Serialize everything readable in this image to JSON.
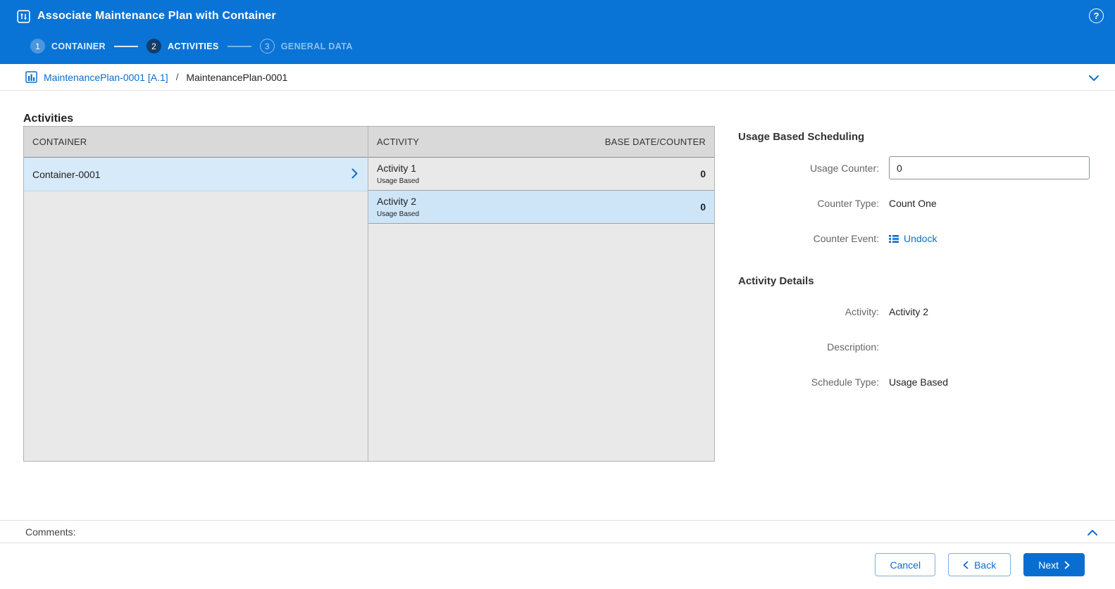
{
  "header": {
    "title": "Associate Maintenance Plan with Container",
    "steps": [
      {
        "number": "1",
        "label": "CONTAINER",
        "state": "done"
      },
      {
        "number": "2",
        "label": "ACTIVITIES",
        "state": "active"
      },
      {
        "number": "3",
        "label": "GENERAL DATA",
        "state": "upcoming"
      }
    ],
    "help_glyph": "?"
  },
  "breadcrumb": {
    "link_label": "MaintenancePlan-0001 [A.1]",
    "separator": "/",
    "current": "MaintenancePlan-0001"
  },
  "activities": {
    "section_title": "Activities",
    "container_table": {
      "header": "CONTAINER",
      "rows": [
        {
          "name": "Container-0001",
          "selected": true
        }
      ]
    },
    "activity_table": {
      "header_activity": "ACTIVITY",
      "header_base": "BASE DATE/COUNTER",
      "rows": [
        {
          "name": "Activity 1",
          "type": "Usage Based",
          "counter": "0",
          "selected": false
        },
        {
          "name": "Activity 2",
          "type": "Usage Based",
          "counter": "0",
          "selected": true
        }
      ]
    }
  },
  "panel": {
    "usage_section_title": "Usage Based Scheduling",
    "usage_counter": {
      "label": "Usage Counter:",
      "value": "0"
    },
    "counter_type": {
      "label": "Counter Type:",
      "value": "Count One"
    },
    "counter_event": {
      "label": "Counter Event:",
      "value": "Undock"
    },
    "details_section_title": "Activity Details",
    "activity": {
      "label": "Activity:",
      "value": "Activity 2"
    },
    "description": {
      "label": "Description:",
      "value": ""
    },
    "schedule_type": {
      "label": "Schedule Type:",
      "value": "Usage Based"
    }
  },
  "comments": {
    "label": "Comments:"
  },
  "footer": {
    "cancel": "Cancel",
    "back": "Back",
    "next": "Next"
  },
  "colors": {
    "header_blue": "#0a74d6",
    "accent_blue": "#0a6ed1",
    "active_step_navy": "#143d69",
    "selected_row_blue": "#cde5f7",
    "table_header_gray": "#d9d9d9",
    "table_body_gray": "#e9e9e9"
  }
}
